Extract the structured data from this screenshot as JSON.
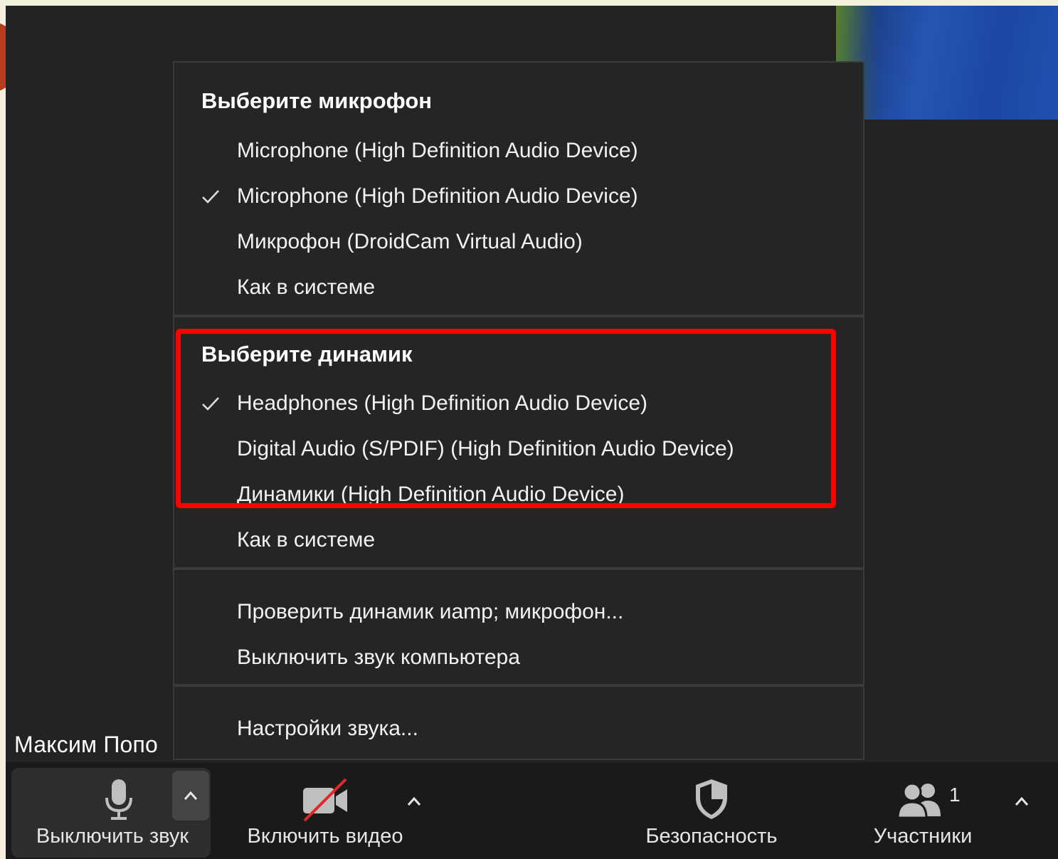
{
  "menu": {
    "mic_section": {
      "heading": "Выберите микрофон",
      "items": [
        {
          "label": "Microphone (High Definition Audio Device)",
          "checked": false
        },
        {
          "label": "Microphone (High Definition Audio Device)",
          "checked": true
        },
        {
          "label": "Микрофон (DroidCam Virtual Audio)",
          "checked": false
        },
        {
          "label": "Как в системе",
          "checked": false
        }
      ]
    },
    "speaker_section": {
      "heading": "Выберите динамик",
      "items": [
        {
          "label": "Headphones (High Definition Audio Device)",
          "checked": true
        },
        {
          "label": "Digital Audio (S/PDIF) (High Definition Audio Device)",
          "checked": false
        },
        {
          "label": "Динамики (High Definition Audio Device)",
          "checked": false
        },
        {
          "label": "Как в системе",
          "checked": false
        }
      ]
    },
    "actions": {
      "test": "Проверить динамик иamp; микрофон...",
      "leave_audio": "Выключить звук компьютера",
      "settings": "Настройки звука..."
    }
  },
  "participant_name": "Максим Попо",
  "toolbar": {
    "mute": "Выключить звук",
    "video": "Включить видео",
    "security": "Безопасность",
    "participants": "Участники",
    "participants_count": "1"
  },
  "colors": {
    "highlight": "#ff0000",
    "menu_bg": "#252525",
    "toolbar_bg": "#1a1a1a"
  }
}
